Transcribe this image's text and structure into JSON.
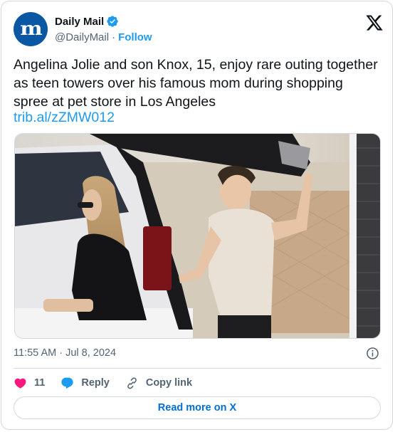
{
  "author": {
    "display_name": "Daily Mail",
    "handle": "@DailyMail",
    "separator": "·",
    "follow_label": "Follow",
    "avatar_letters": "m",
    "verified": true
  },
  "tweet": {
    "text": "Angelina Jolie and son Knox, 15, enjoy rare outing together as teen towers over his famous mom during shopping spree at pet store in Los Angeles",
    "link": "trib.al/zZMW012",
    "timestamp": "11:55 AM · Jul 8, 2024"
  },
  "actions": {
    "like_count": "11",
    "reply_label": "Reply",
    "copy_link_label": "Copy link"
  },
  "footer": {
    "read_more_label": "Read more on X"
  },
  "icons": {
    "logo": "x-logo-icon",
    "verified": "verified-badge-icon",
    "info": "info-icon",
    "like": "heart-icon",
    "reply": "reply-bubble-icon",
    "copy_link": "link-icon"
  },
  "colors": {
    "accent": "#1d9bf0",
    "like": "#f91880",
    "avatar_bg": "#0a57a4",
    "read_more_text": "#006fd6"
  }
}
